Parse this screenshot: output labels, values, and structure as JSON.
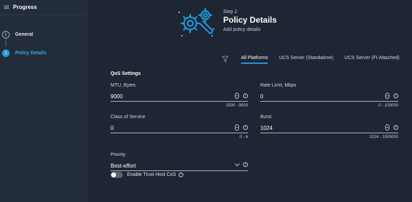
{
  "sidebar": {
    "title": "Progress",
    "steps": [
      {
        "number": "1",
        "label": "General",
        "active": false
      },
      {
        "number": "2",
        "label": "Policy Details",
        "active": true
      }
    ]
  },
  "header": {
    "step": "Step 2",
    "title": "Policy Details",
    "subtitle": "Add policy details",
    "icon": "gears-wrench-icon"
  },
  "platforms": {
    "filter_icon": "filter-icon",
    "tabs": [
      "All Platforms",
      "UCS Server (Standalone)",
      "UCS Server (FI-Attached)"
    ],
    "active": "All Platforms"
  },
  "qos": {
    "section_title": "QoS Settings",
    "mtu": {
      "label": "MTU, Bytes",
      "value": "9000",
      "hint": "1500 - 9000"
    },
    "rate_limit": {
      "label": "Rate Limit, Mbps",
      "value": "0",
      "hint": "0 - 100000"
    },
    "class_of_service": {
      "label": "Class of Service",
      "value": "0",
      "hint": "0 - 6"
    },
    "burst": {
      "label": "Burst",
      "value": "1024",
      "hint": "1024 - 1000000"
    },
    "priority": {
      "label": "Priority",
      "value": "Best-effort"
    },
    "trust_host_cos": {
      "label": "Enable Trust Host CoS",
      "enabled": false
    }
  },
  "colors": {
    "accent": "#1e9ad6",
    "background": "#1e2533",
    "sidebar": "#232c3b"
  }
}
